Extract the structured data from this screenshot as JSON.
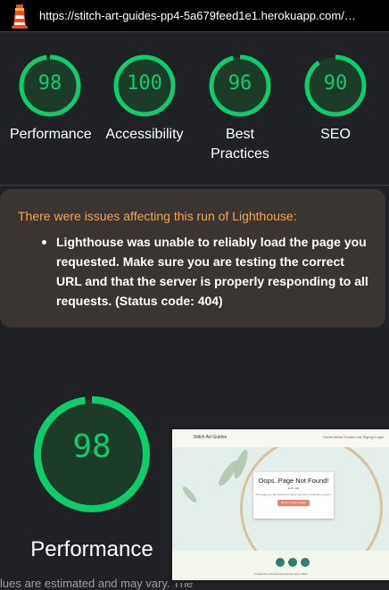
{
  "url_bar": {
    "url": "https://stitch-art-guides-pp4-5a679feed1e1.herokuapp.com/…",
    "logo_icon": "lighthouse-icon"
  },
  "scores": [
    {
      "value": "98",
      "label": "Performance",
      "score": 98
    },
    {
      "value": "100",
      "label": "Accessibility",
      "score": 100
    },
    {
      "value": "96",
      "label": "Best Practices",
      "score": 96
    },
    {
      "value": "90",
      "label": "SEO",
      "score": 90
    }
  ],
  "warning": {
    "title": "There were issues affecting this run of Lighthouse:",
    "items": [
      "Lighthouse was unable to reliably load the page you requested. Make sure you are testing the correct URL and that the server is properly responding to all requests. (Status code: 404)"
    ]
  },
  "performance": {
    "value": "98",
    "score": 98,
    "label": "Performance",
    "footnote": "lues are estimated and may vary. The"
  },
  "thumbnail": {
    "brand": "Stitch Art Guides",
    "nav_links": "Home  About  Guides List  Signup  Login",
    "card_title": "Oops..Page Not Found!",
    "card_subtitle": "Error 404",
    "card_text": "The page you are looking for does not exist or has been moved.",
    "card_button": "Return to Homepage",
    "copyright": "Created for educational purposes only | 2024"
  },
  "colors": {
    "pass": "#0cce6b",
    "warning_title": "#f0a55a",
    "background": "#202124"
  }
}
